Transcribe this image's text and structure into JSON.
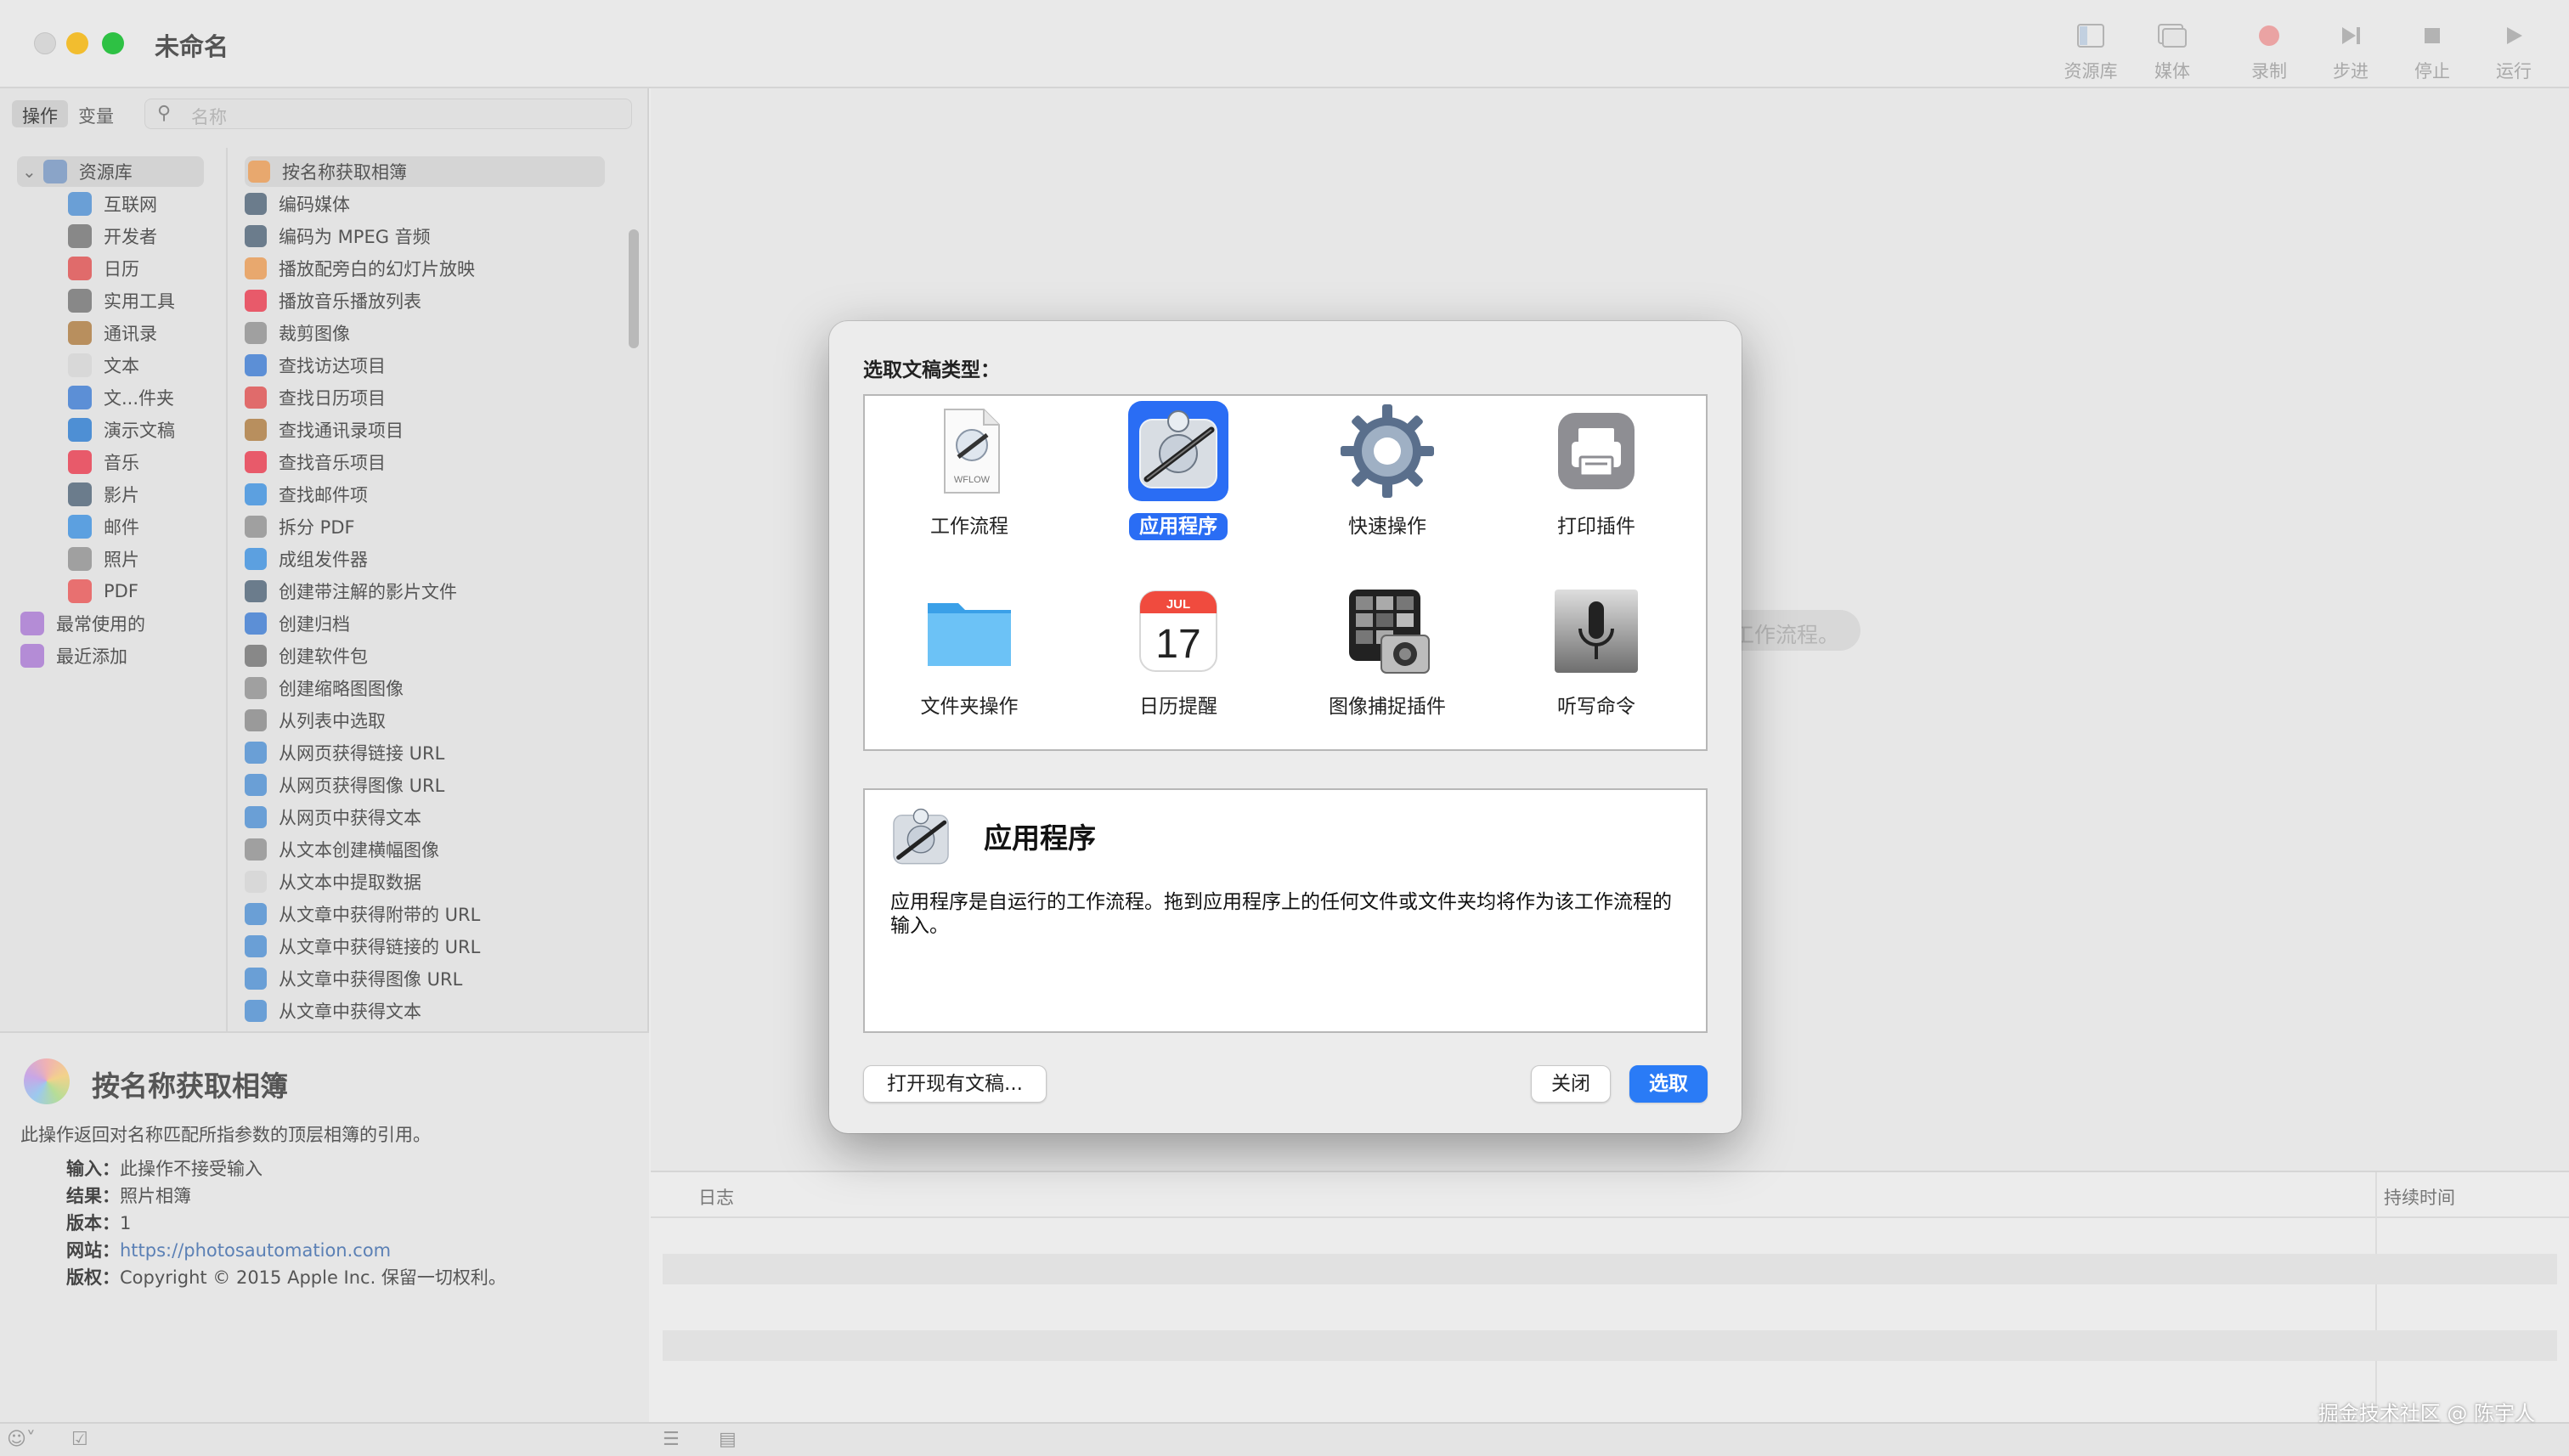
{
  "window": {
    "title": "未命名",
    "toolbar": [
      {
        "label": "资源库",
        "icon": "library-icon"
      },
      {
        "label": "媒体",
        "icon": "media-icon"
      },
      {
        "label": "录制",
        "icon": "record-icon"
      },
      {
        "label": "步进",
        "icon": "step-icon"
      },
      {
        "label": "停止",
        "icon": "stop-icon"
      },
      {
        "label": "运行",
        "icon": "run-icon"
      }
    ]
  },
  "library": {
    "segments": [
      "操作",
      "变量"
    ],
    "search_placeholder": "名称",
    "categories": [
      {
        "label": "资源库",
        "color": "#8aa4c8"
      },
      {
        "label": "互联网",
        "color": "#6a9fd6"
      },
      {
        "label": "开发者",
        "color": "#888888"
      },
      {
        "label": "日历",
        "color": "#e06b6b"
      },
      {
        "label": "实用工具",
        "color": "#888888"
      },
      {
        "label": "通讯录",
        "color": "#b88f5e"
      },
      {
        "label": "文本",
        "color": "#d8d8d8"
      },
      {
        "label": "文...件夹",
        "color": "#5c8fd6"
      },
      {
        "label": "演示文稿",
        "color": "#4e8fd4"
      },
      {
        "label": "音乐",
        "color": "#e85a6a"
      },
      {
        "label": "影片",
        "color": "#6b7c8c"
      },
      {
        "label": "邮件",
        "color": "#5ca0e0"
      },
      {
        "label": "照片",
        "color": "#a0a0a0"
      },
      {
        "label": "PDF",
        "color": "#e87070"
      },
      {
        "label": "最常使用的",
        "color": "#b48cd6"
      },
      {
        "label": "最近添加",
        "color": "#b48cd6"
      }
    ],
    "actions": [
      {
        "label": "按名称获取相簿",
        "color": "#e8a86e"
      },
      {
        "label": "编码媒体",
        "color": "#6b7c8c"
      },
      {
        "label": "编码为 MPEG 音频",
        "color": "#6b7c8c"
      },
      {
        "label": "播放配旁白的幻灯片放映",
        "color": "#e8a86e"
      },
      {
        "label": "播放音乐播放列表",
        "color": "#e85a6a"
      },
      {
        "label": "裁剪图像",
        "color": "#a0a0a0"
      },
      {
        "label": "查找访达项目",
        "color": "#5c8fd6"
      },
      {
        "label": "查找日历项目",
        "color": "#e06b6b"
      },
      {
        "label": "查找通讯录项目",
        "color": "#b88f5e"
      },
      {
        "label": "查找音乐项目",
        "color": "#e85a6a"
      },
      {
        "label": "查找邮件项",
        "color": "#5ca0e0"
      },
      {
        "label": "拆分 PDF",
        "color": "#a0a0a0"
      },
      {
        "label": "成组发件器",
        "color": "#5ca0e0"
      },
      {
        "label": "创建带注解的影片文件",
        "color": "#6b7c8c"
      },
      {
        "label": "创建归档",
        "color": "#5c8fd6"
      },
      {
        "label": "创建软件包",
        "color": "#888888"
      },
      {
        "label": "创建缩略图图像",
        "color": "#a0a0a0"
      },
      {
        "label": "从列表中选取",
        "color": "#9a9a9a"
      },
      {
        "label": "从网页获得链接 URL",
        "color": "#6a9fd6"
      },
      {
        "label": "从网页获得图像 URL",
        "color": "#6a9fd6"
      },
      {
        "label": "从网页中获得文本",
        "color": "#6a9fd6"
      },
      {
        "label": "从文本创建横幅图像",
        "color": "#a0a0a0"
      },
      {
        "label": "从文本中提取数据",
        "color": "#d8d8d8"
      },
      {
        "label": "从文章中获得附带的 URL",
        "color": "#6a9fd6"
      },
      {
        "label": "从文章中获得链接的 URL",
        "color": "#6a9fd6"
      },
      {
        "label": "从文章中获得图像 URL",
        "color": "#6a9fd6"
      },
      {
        "label": "从文章中获得文本",
        "color": "#6a9fd6"
      }
    ]
  },
  "description": {
    "title": "按名称获取相簿",
    "summary": "此操作返回对名称匹配所指参数的顶层相簿的引用。",
    "input_label": "输入：",
    "input_value": "此操作不接受输入",
    "result_label": "结果：",
    "result_value": "照片相簿",
    "version_label": "版本：",
    "version_value": "1",
    "website_label": "网站：",
    "website_value": "https://photosautomation.com",
    "copyright_label": "版权：",
    "copyright_value": "Copyright © 2015 Apple Inc. 保留一切权利。"
  },
  "workflow_hint": "工作流程。",
  "log": {
    "col_log": "日志",
    "col_duration": "持续时间"
  },
  "watermark": "掘金技术社区 @ 陈宇人",
  "dialog": {
    "title": "选取文稿类型：",
    "types": [
      {
        "label": "工作流程",
        "icon": "workflow-file-icon"
      },
      {
        "label": "应用程序",
        "icon": "automator-app-icon",
        "selected": true
      },
      {
        "label": "快速操作",
        "icon": "gear-icon"
      },
      {
        "label": "打印插件",
        "icon": "printer-icon"
      },
      {
        "label": "文件夹操作",
        "icon": "folder-icon"
      },
      {
        "label": "日历提醒",
        "icon": "calendar-icon"
      },
      {
        "label": "图像捕捉插件",
        "icon": "image-capture-icon"
      },
      {
        "label": "听写命令",
        "icon": "microphone-icon"
      }
    ],
    "calendar_month": "JUL",
    "calendar_day": "17",
    "workflow_file_text": "WFLOW",
    "info_title": "应用程序",
    "info_desc": "应用程序是自运行的工作流程。拖到应用程序上的任何文件或文件夹均将作为该工作流程的输入。",
    "btn_open": "打开现有文稿...",
    "btn_close": "关闭",
    "btn_choose": "选取"
  }
}
